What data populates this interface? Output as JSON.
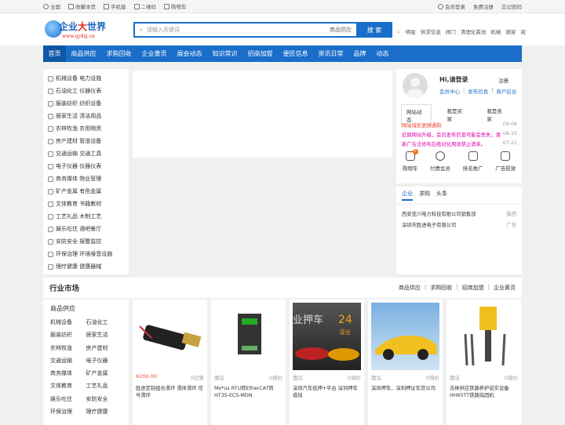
{
  "topbar": {
    "left": [
      "全国",
      "收藏本页",
      "手机版",
      "二维码",
      "购物车"
    ],
    "right": [
      "会员登录",
      "免费注册",
      "忘记密码"
    ]
  },
  "logo": {
    "text_a": "企业",
    "text_b": "大",
    "text_c": "世界",
    "url": "www.qydsj.cn"
  },
  "search": {
    "placeholder": "请输入关键词",
    "category": "商品供应",
    "button": "搜 索"
  },
  "hotlinks": [
    "明星",
    "供求信息",
    "阀门",
    "清理化粪池",
    "机械",
    "谢家",
    "阅"
  ],
  "nav": [
    "首页",
    "商品供应",
    "求购回收",
    "企业黄页",
    "展会动态",
    "知识常识",
    "招商加盟",
    "便民信息",
    "资讯日常",
    "品牌",
    "动态"
  ],
  "categories": [
    "机械设备 电力设施",
    "石油化工 仪器仪表",
    "服装纺织 纺织设备",
    "居家生活 清洁用品",
    "农林牧渔 农用物资",
    "房产建材 管道设备",
    "交通运输 交通工具",
    "电子仪器 仪器仪表",
    "商务媒体 物业管理",
    "矿产金属 有色金属",
    "文体教育 书籍教材",
    "工艺礼品 木制工艺",
    "娱乐吃住 酒吧餐厅",
    "安防安全 报警监控",
    "环保治理 环境噪音设施",
    "理疗健康 健康器械"
  ],
  "user": {
    "greeting": "Hi,请登录",
    "register": "注册",
    "links": [
      "会员中心",
      "|",
      "发布信息",
      "|",
      "商户后台"
    ],
    "tabs": [
      "网站动态",
      "我是买家",
      "我是卖家"
    ],
    "notices": [
      {
        "text": "网站域名更换通知",
        "date": "09-06"
      },
      {
        "text": "近期网站升级，会员发布信息可能会丢失，请",
        "date": "08-15"
      },
      {
        "text": "新广告法修布后绝对化用语禁止清单。",
        "date": "07-21"
      }
    ],
    "shortcuts": [
      "购物车",
      "付费会员",
      "排名推广",
      "广告投放"
    ],
    "cart_count": "0"
  },
  "companies": {
    "tabs": [
      "企业",
      "求购",
      "头条"
    ],
    "rows": [
      {
        "name": "西安亚川电力科技有限公司销售部",
        "loc": "陕西"
      },
      {
        "name": "深圳市胜进电子有限公司",
        "loc": "广东"
      }
    ]
  },
  "market": {
    "title": "行业市场",
    "links": [
      "商品供应",
      "|",
      "求购回收",
      "|",
      "招商加盟",
      "|",
      "企业黄页"
    ],
    "cat_title": "商品供应",
    "cats": [
      "机械设备",
      "石油化工",
      "服装纺织",
      "居家生活",
      "农林牧渔",
      "房产建材",
      "交通运输",
      "电子仪器",
      "商务媒体",
      "矿产金属",
      "文体教育",
      "工艺礼品",
      "娱乐吃住",
      "安防安全",
      "环保治理",
      "理疗健康"
    ],
    "products": [
      {
        "price": "¥200.00",
        "sold": "0已售",
        "name": "胜进定制组合滑环 滑体滑环 信号滑环"
      },
      {
        "price": "面议",
        "sold": "0询价",
        "name": "Mo*us RTU转EtherCAT转HT3S-ECS-MDN"
      },
      {
        "price": "面议",
        "sold": "0询价",
        "name": "深圳汽车抵押+平台 深圳押车借钱"
      },
      {
        "price": "面议",
        "sold": "0询价",
        "name": "深圳押车，深圳押证车贷公司"
      },
      {
        "price": "面议",
        "sold": "0询价",
        "name": "吉林供应铁路养护前实设备HH65TT铁路捣固机"
      }
    ],
    "promo_text": "业押车",
    "promo_num": "24",
    "promo_sub": "营业"
  }
}
